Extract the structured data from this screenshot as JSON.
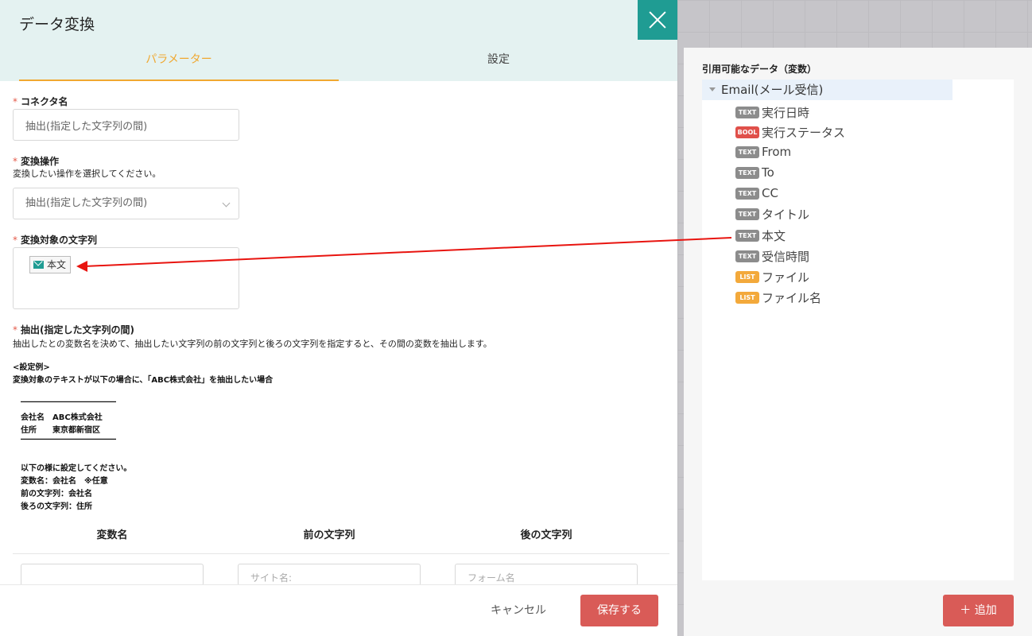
{
  "dialog": {
    "title": "データ変換",
    "tabs": [
      {
        "label": "パラメーター",
        "active": true
      },
      {
        "label": "設定",
        "active": false
      }
    ]
  },
  "form": {
    "required_mark": "*",
    "connector_name": {
      "label": "コネクタ名",
      "value": "抽出(指定した文字列の間)"
    },
    "operation": {
      "label": "変換操作",
      "description": "変換したい操作を選択してください。",
      "value": "抽出(指定した文字列の間)"
    },
    "target": {
      "label": "変換対象の文字列",
      "chip": "本文"
    },
    "extract": {
      "label": "抽出(指定した文字列の間)",
      "description": "抽出したとの変数名を決めて、抽出したい文字列の前の文字列と後ろの文字列を指定すると、その間の変数を抽出します。",
      "example_lines": [
        "<設定例>",
        "変換対象のテキストが以下の場合に、「ABC株式会社」を抽出したい場合",
        "――――――――――――",
        "会社名　ABC株式会社",
        "住所　　東京都新宿区",
        "――――――――――――",
        "以下の様に設定してください。",
        "変数名：会社名　※任意",
        "前の文字列：会社名",
        "後ろの文字列：住所"
      ]
    },
    "table": {
      "headers": [
        "変数名",
        "前の文字列",
        "後の文字列"
      ],
      "placeholders": [
        "",
        "サイト名:",
        "フォーム名"
      ]
    }
  },
  "footer": {
    "cancel_label": "キャンセル",
    "save_label": "保存する"
  },
  "variables": {
    "title": "引用可能なデータ（変数）",
    "root": "Email(メール受信)",
    "items": [
      {
        "type": "TEXT",
        "label": "実行日時"
      },
      {
        "type": "BOOL",
        "label": "実行ステータス"
      },
      {
        "type": "TEXT",
        "label": "From"
      },
      {
        "type": "TEXT",
        "label": "To"
      },
      {
        "type": "TEXT",
        "label": "CC"
      },
      {
        "type": "TEXT",
        "label": "タイトル"
      },
      {
        "type": "TEXT",
        "label": "本文"
      },
      {
        "type": "TEXT",
        "label": "受信時間"
      },
      {
        "type": "LIST",
        "label": "ファイル"
      },
      {
        "type": "LIST",
        "label": "ファイル名"
      }
    ],
    "badge_colors": {
      "TEXT": "#8c8c8c",
      "BOOL": "#e0504a",
      "LIST": "#f3a93b"
    },
    "add_label": "＋ 追加"
  },
  "colors": {
    "accent": "#1f9c93",
    "tab_active": "#f0a830",
    "primary_button": "#d95b57",
    "annotation_arrow": "#e8140f"
  }
}
